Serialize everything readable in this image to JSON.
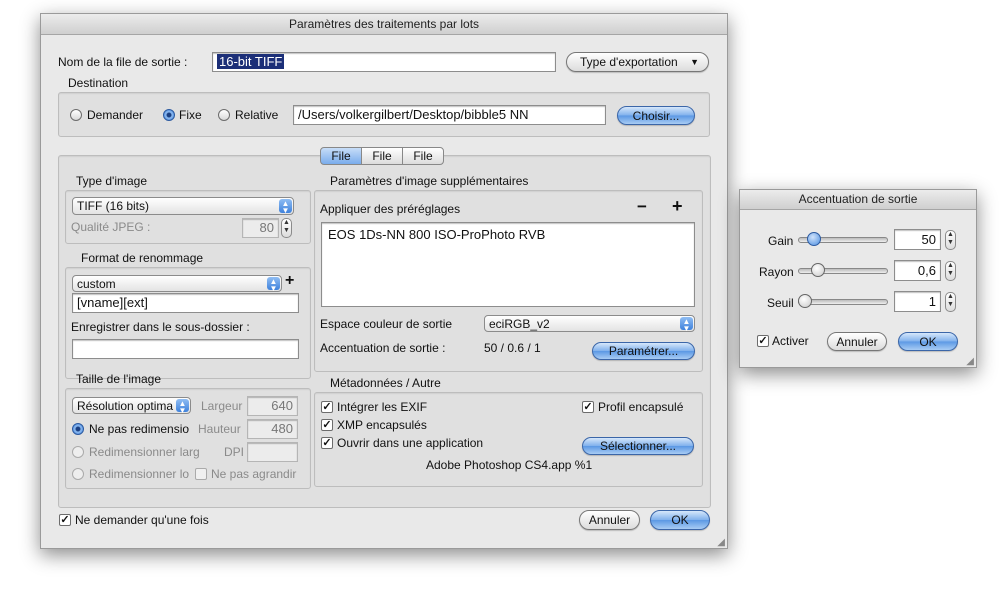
{
  "main": {
    "title": "Paramètres des traitements par lots",
    "output_name_label": "Nom de la file de sortie :",
    "output_name_value": "16-bit TIFF",
    "export_type_button": "Type d'exportation",
    "destination": {
      "title": "Destination",
      "radio_ask": "Demander",
      "radio_fixed": "Fixe",
      "radio_relative": "Relative",
      "selected": "Fixe",
      "path": "/Users/volkergilbert/Desktop/bibble5 NN",
      "choose_button": "Choisir..."
    },
    "tabs": [
      "File",
      "File",
      "File"
    ],
    "image_type": {
      "title": "Type d'image",
      "format": "TIFF (16 bits)",
      "jpeg_quality_label": "Qualité JPEG :",
      "jpeg_quality_value": "80"
    },
    "rename": {
      "title": "Format de renommage",
      "preset": "custom",
      "pattern": "[vname][ext]",
      "subfolder_label": "Enregistrer dans le sous-dossier :",
      "subfolder_value": ""
    },
    "image_size": {
      "title": "Taille de l'image",
      "mode": "Résolution optima",
      "width_label": "Largeur",
      "width_value": "640",
      "height_label": "Hauteur",
      "height_value": "480",
      "dpi_label": "DPI",
      "dpi_value": "",
      "opt_no_resize": "Ne pas redimensio",
      "opt_resize_width": "Redimensionner larg",
      "opt_resize_long": "Redimensionner lo",
      "no_enlarge": "Ne pas agrandir"
    },
    "extra": {
      "title": "Paramètres d'image supplémentaires",
      "apply_presets_label": "Appliquer des préréglages",
      "minus": "−",
      "plus": "+",
      "presets": [
        "EOS 1Ds-NN 800 ISO-ProPhoto RVB"
      ],
      "color_space_label": "Espace couleur de sortie",
      "color_space_value": "eciRGB_v2",
      "sharpen_label": "Accentuation de sortie :",
      "sharpen_value": "50 / 0.6 / 1",
      "configure_button": "Paramétrer..."
    },
    "metadata": {
      "title": "Métadonnées / Autre",
      "embed_exif": "Intégrer les EXIF",
      "embed_profile": "Profil encapsulé",
      "xmp": "XMP encapsulés",
      "open_in_app": "Ouvrir dans une application",
      "select_button": "Sélectionner...",
      "app_name": "Adobe Photoshop CS4.app %1"
    },
    "ask_once": "Ne demander qu'une fois",
    "cancel": "Annuler",
    "ok": "OK"
  },
  "sharpen_dialog": {
    "title": "Accentuation de sortie",
    "gain_label": "Gain",
    "gain_value": "50",
    "radius_label": "Rayon",
    "radius_value": "0,6",
    "threshold_label": "Seuil",
    "threshold_value": "1",
    "activate_label": "Activer",
    "cancel": "Annuler",
    "ok": "OK"
  }
}
